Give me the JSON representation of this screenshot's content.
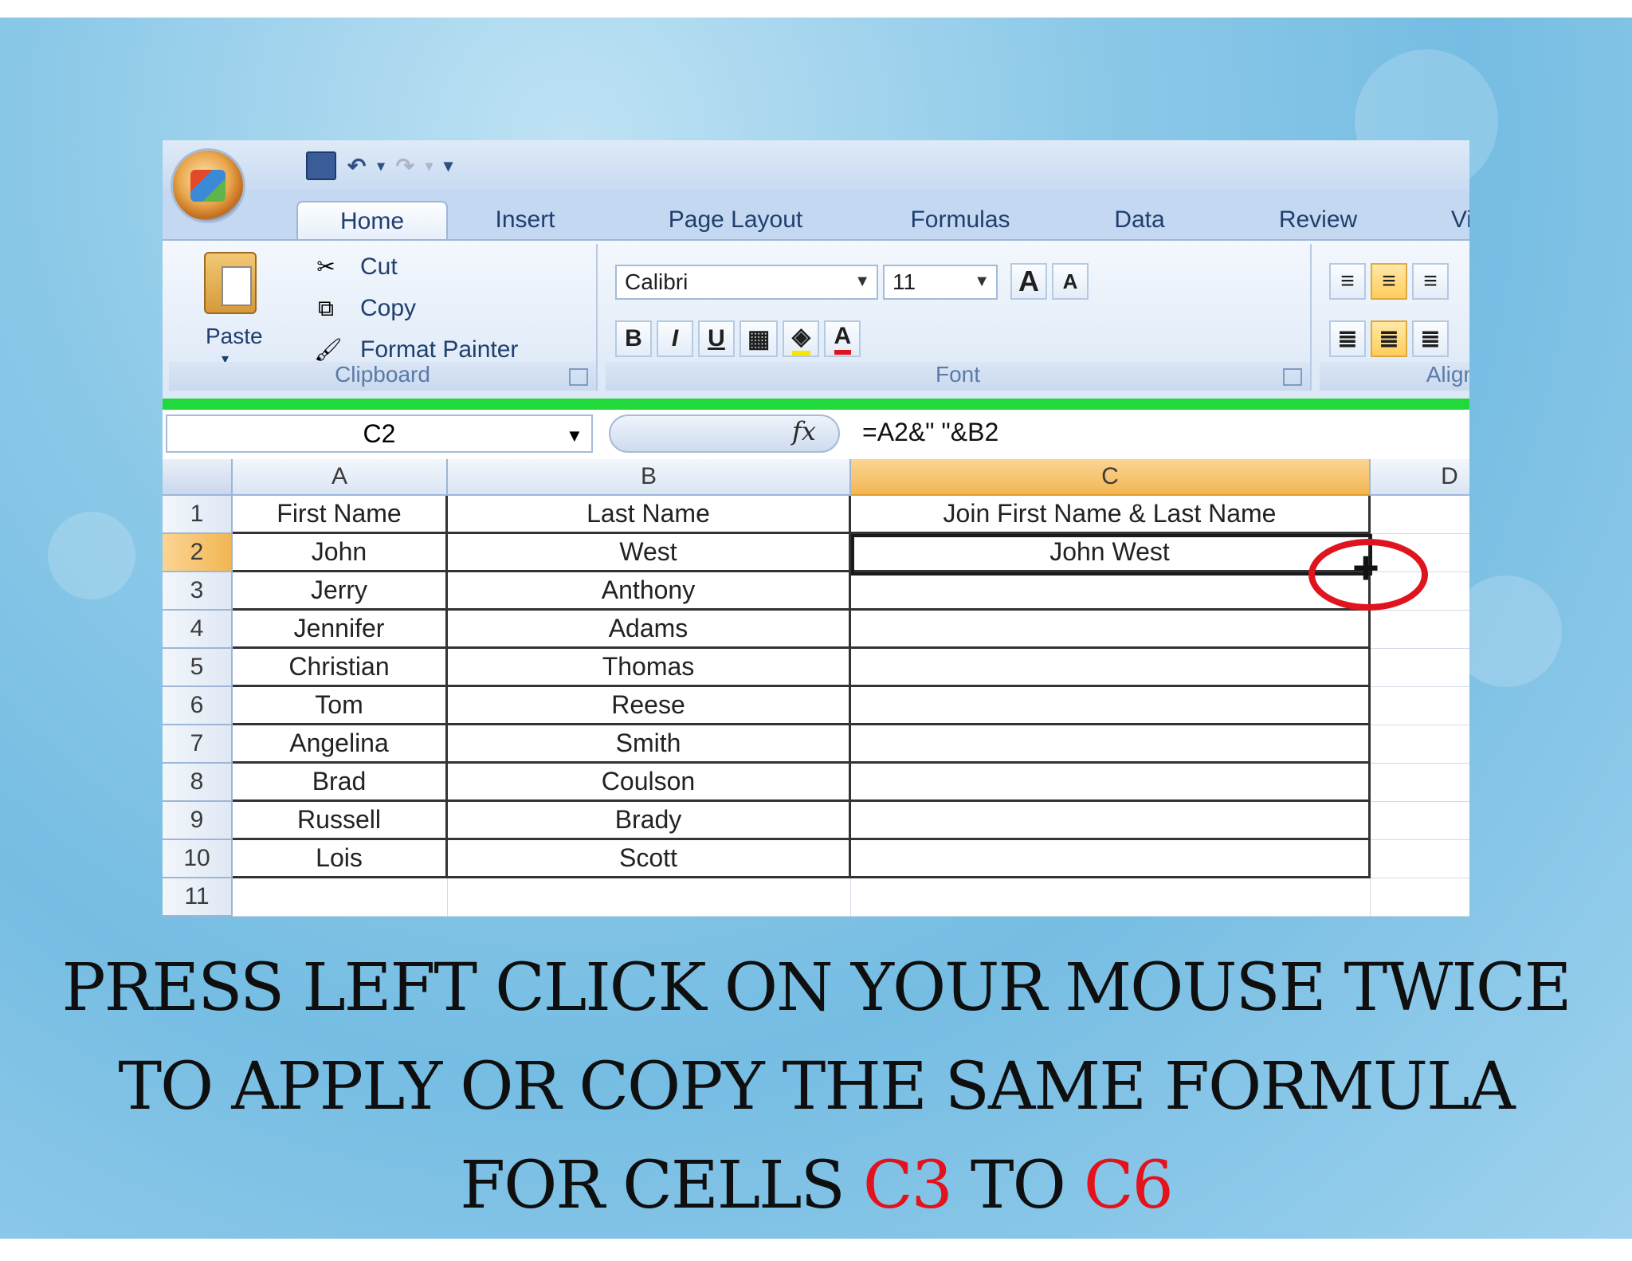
{
  "quick_access": {
    "save_icon": "save-icon",
    "undo_icon": "undo-icon",
    "redo_icon": "redo-icon",
    "customize": "▾"
  },
  "tabs": [
    "Home",
    "Insert",
    "Page Layout",
    "Formulas",
    "Data",
    "Review",
    "Vi"
  ],
  "active_tab": "Home",
  "ribbon": {
    "clipboard": {
      "paste": "Paste",
      "cut": "Cut",
      "copy": "Copy",
      "format_painter": "Format Painter",
      "label": "Clipboard"
    },
    "font": {
      "font_name": "Calibri",
      "font_size": "11",
      "grow": "A",
      "shrink": "A",
      "bold": "B",
      "italic": "I",
      "underline": "U",
      "label": "Font"
    },
    "alignment": {
      "label": "Align"
    }
  },
  "formula_bar": {
    "name_box": "C2",
    "fx": "fx",
    "formula": "=A2&\" \"&B2"
  },
  "columns": [
    "A",
    "B",
    "C",
    "D"
  ],
  "selected_column": "C",
  "rows": [
    {
      "n": "1",
      "a": "First Name",
      "b": "Last Name",
      "c": "Join First Name & Last Name"
    },
    {
      "n": "2",
      "a": "John",
      "b": "West",
      "c": "John West"
    },
    {
      "n": "3",
      "a": "Jerry",
      "b": "Anthony",
      "c": ""
    },
    {
      "n": "4",
      "a": "Jennifer",
      "b": "Adams",
      "c": ""
    },
    {
      "n": "5",
      "a": "Christian",
      "b": "Thomas",
      "c": ""
    },
    {
      "n": "6",
      "a": "Tom",
      "b": "Reese",
      "c": ""
    },
    {
      "n": "7",
      "a": "Angelina",
      "b": "Smith",
      "c": ""
    },
    {
      "n": "8",
      "a": "Brad",
      "b": "Coulson",
      "c": ""
    },
    {
      "n": "9",
      "a": "Russell",
      "b": "Brady",
      "c": ""
    },
    {
      "n": "10",
      "a": "Lois",
      "b": "Scott",
      "c": ""
    },
    {
      "n": "11",
      "a": "",
      "b": "",
      "c": ""
    }
  ],
  "selected_row": "2",
  "instruction": {
    "line1": "PRESS LEFT CLICK ON YOUR MOUSE TWICE",
    "line2": "TO APPLY OR COPY THE SAME FORMULA",
    "line3_prefix": "FOR CELLS",
    "cell_from": "C3",
    "line3_middle": "TO",
    "cell_to": "C6"
  },
  "colors": {
    "highlight": "#e3121b",
    "green_bar": "#21d93a",
    "selected_header": "#f2b653"
  }
}
